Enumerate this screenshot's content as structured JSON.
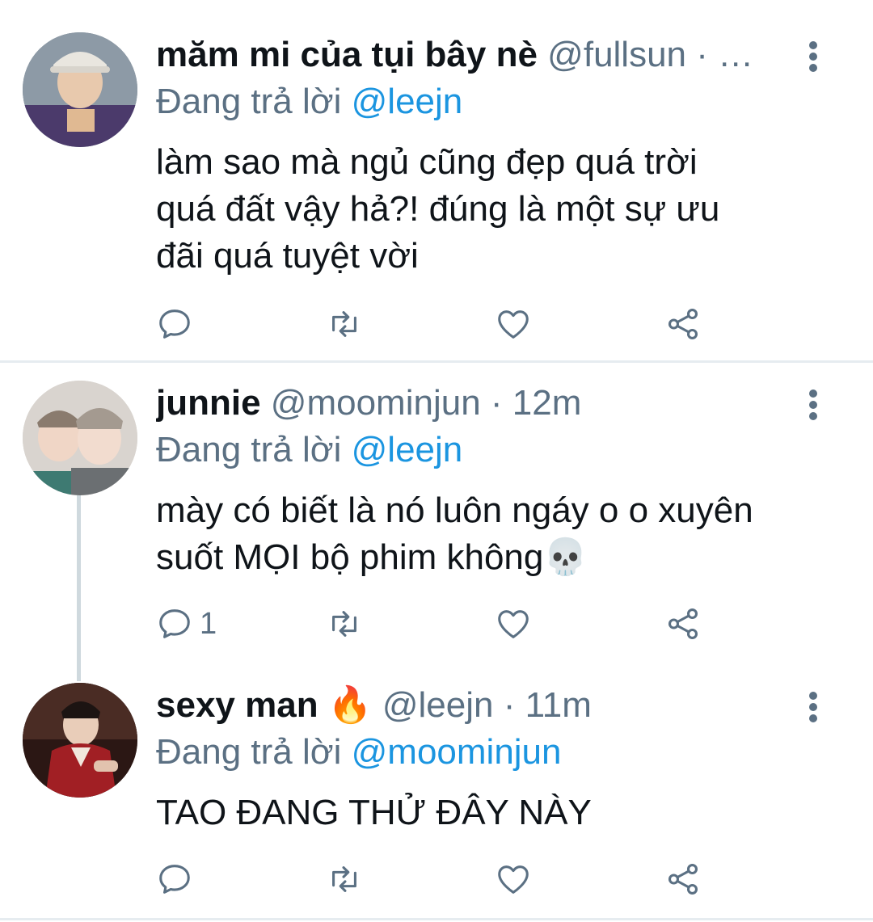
{
  "tweets": [
    {
      "name": "măm mi của tụi bây nè",
      "handle": "@fullsun",
      "meta": " · …",
      "replying_prefix": "Đang trả lời ",
      "replying_to": "@leejn",
      "text_lines": [
        "làm sao mà ngủ cũng đẹp quá trời",
        "quá đất vậy hả?! đúng là một sự ưu",
        "đãi quá tuyệt vời"
      ],
      "reply_count": "",
      "avatar_bg": "#5a6a78"
    },
    {
      "name": "junnie",
      "handle": "@moominjun",
      "meta": " · 12m",
      "replying_prefix": "Đang trả lời ",
      "replying_to": "@leejn",
      "text_lines": [
        "mày có biết là nó luôn ngáy o o xuyên",
        "suốt MỌI bộ phim không💀"
      ],
      "reply_count": "1",
      "avatar_bg": "#c9c3bd"
    },
    {
      "name": "sexy man 🔥",
      "handle": "@leejn",
      "meta": " · 11m",
      "replying_prefix": "Đang trả lời ",
      "replying_to": "@moominjun",
      "text_lines": [
        "TAO ĐANG THỬ ĐÂY NÀY"
      ],
      "reply_count": "",
      "avatar_bg": "#3a1d1a"
    }
  ],
  "icons": {
    "reply": "reply-icon",
    "retweet": "retweet-icon",
    "like": "like-icon",
    "share": "share-icon",
    "more": "more-options-icon"
  },
  "colors": {
    "text": "#0f1419",
    "secondary": "#5b7083",
    "link": "#1b95e0",
    "divider": "#e6ecf0",
    "thread_line": "#cfd9de"
  }
}
